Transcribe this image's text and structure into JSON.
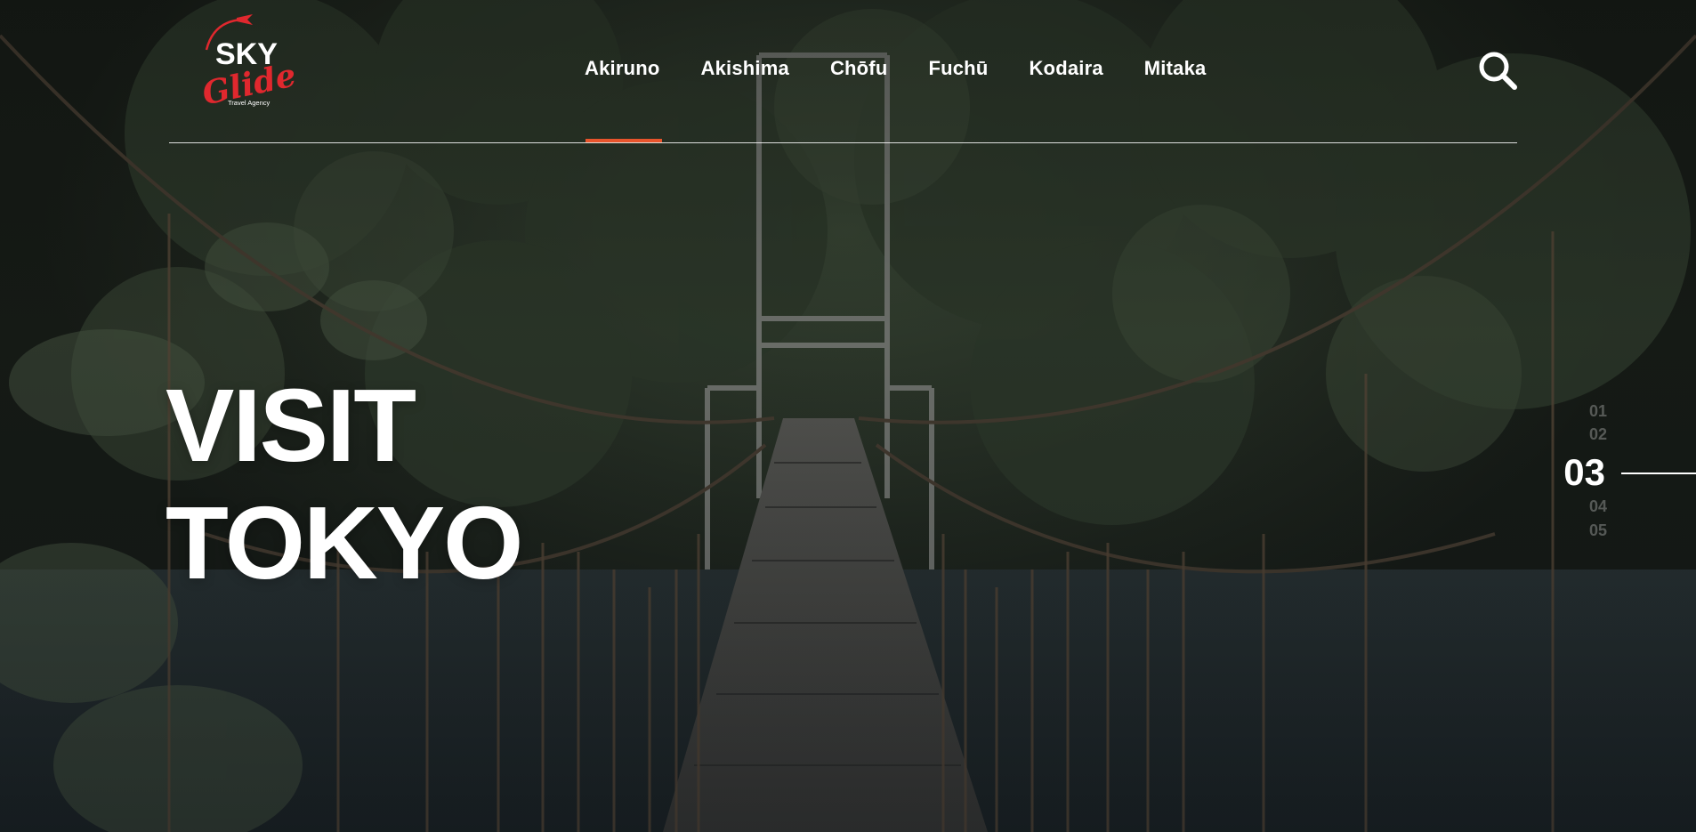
{
  "brand": {
    "logo_top": "SKY",
    "logo_script": "Glide",
    "logo_tagline": "Travel Agency"
  },
  "nav": {
    "items": [
      {
        "label": "Akiruno",
        "active": true
      },
      {
        "label": "Akishima",
        "active": false
      },
      {
        "label": "Chōfu",
        "active": false
      },
      {
        "label": "Fuchū",
        "active": false
      },
      {
        "label": "Kodaira",
        "active": false
      },
      {
        "label": "Mitaka",
        "active": false
      }
    ],
    "search_icon": "search-icon"
  },
  "hero": {
    "title_line1": "VISIT",
    "title_line2": "TOKYO"
  },
  "slides": {
    "items": [
      "01",
      "02",
      "03",
      "04",
      "05"
    ],
    "current": "03"
  },
  "colors": {
    "accent": "#e8542c",
    "text": "#ffffff",
    "logo_red": "#e0282e"
  }
}
